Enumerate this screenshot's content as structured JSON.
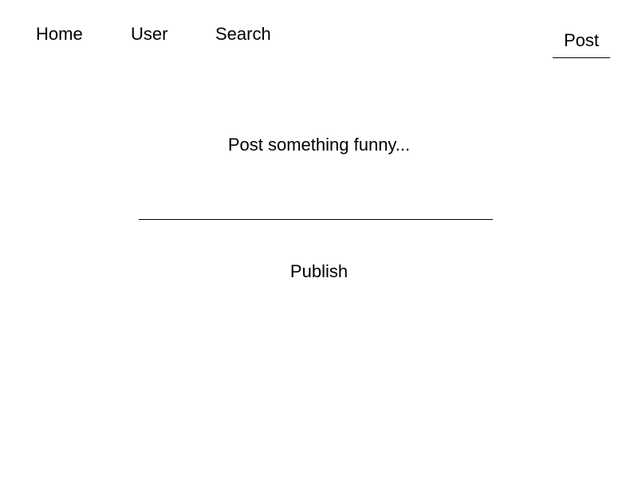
{
  "nav": {
    "items": [
      {
        "label": "Home"
      },
      {
        "label": "User"
      },
      {
        "label": "Search"
      }
    ],
    "post_tab_label": "Post"
  },
  "main": {
    "prompt": "Post something funny...",
    "input_value": "",
    "publish_label": "Publish"
  }
}
